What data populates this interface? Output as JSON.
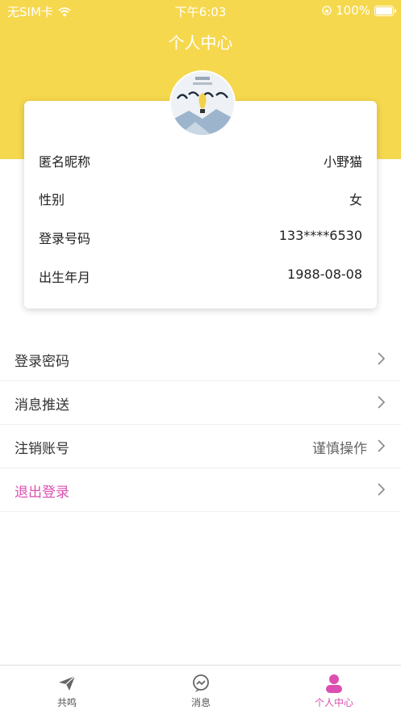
{
  "status_bar": {
    "carrier": "无SIM卡",
    "time": "下午6:03",
    "battery": "100%"
  },
  "header": {
    "title": "个人中心"
  },
  "profile": {
    "rows": [
      {
        "label": "匿名昵称",
        "value": "小野猫"
      },
      {
        "label": "性别",
        "value": "女"
      },
      {
        "label": "登录号码",
        "value": "133****6530"
      },
      {
        "label": "出生年月",
        "value": "1988-08-08"
      }
    ]
  },
  "menu": {
    "password": "登录密码",
    "push": "消息推送",
    "deactivate": "注销账号",
    "deactivate_hint": "谨慎操作",
    "logout": "退出登录"
  },
  "tabs": [
    {
      "label": "共鸣",
      "icon": "paper-plane-icon"
    },
    {
      "label": "消息",
      "icon": "chat-bubble-icon"
    },
    {
      "label": "个人中心",
      "icon": "person-icon",
      "active": true
    }
  ],
  "colors": {
    "header": "#f6d84e",
    "accent": "#dc4fb0"
  }
}
